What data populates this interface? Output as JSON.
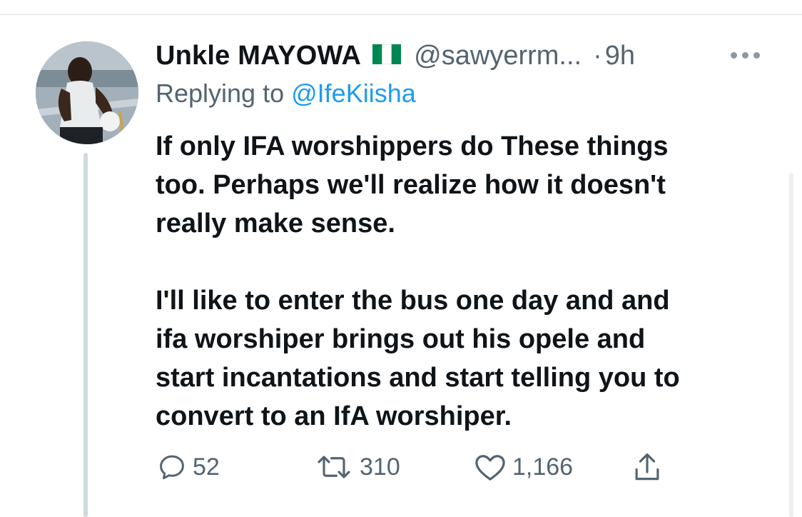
{
  "tweet": {
    "author": {
      "display_name": "Unkle MAYOWA",
      "flag_icon": "nigeria-flag-icon",
      "handle": "@sawyerrm...",
      "dot": "·",
      "time": "9h"
    },
    "reply_prefix": "Replying to",
    "reply_to": "@IfeKiisha",
    "text": {
      "line1": "If only IFA worshippers do These things",
      "line2": "too.  Perhaps we'll realize how it doesn't",
      "line3": "really make sense.",
      "line4": "I'll like to enter the bus one day and and",
      "line5": "ifa worshiper brings out his opele and",
      "line6": "start incantations and start telling you to",
      "line7": "convert to an IfA worshiper."
    },
    "actions": {
      "reply_count": "52",
      "retweet_count": "310",
      "like_count": "1,166"
    }
  },
  "colors": {
    "text_primary": "#0f1419",
    "text_secondary": "#536471",
    "link": "#1d9bf0",
    "divider": "#dcdfe2",
    "thread_line": "#cfd9de",
    "flag_green": "#008751"
  },
  "icons": {
    "more": "more-horizontal-icon",
    "reply": "reply-bubble-icon",
    "retweet": "retweet-icon",
    "like": "heart-icon",
    "share": "share-icon"
  }
}
